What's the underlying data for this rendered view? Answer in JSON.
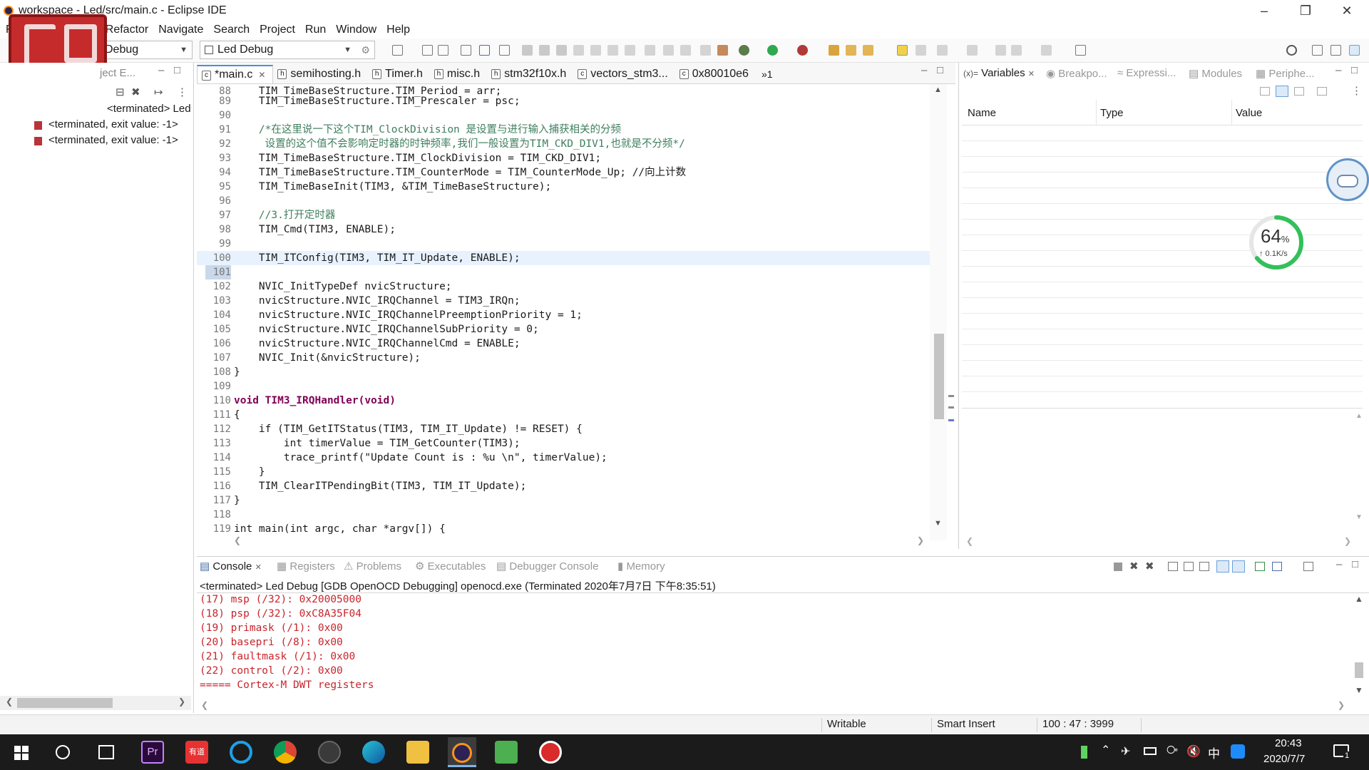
{
  "window": {
    "title": "workspace - Led/src/main.c - Eclipse IDE"
  },
  "menu": [
    "F",
    "Refactor",
    "Navigate",
    "Search",
    "Project",
    "Run",
    "Window",
    "Help"
  ],
  "toolbar": {
    "launch_mode_partial": "Debug",
    "launch_config": "Led Debug"
  },
  "left_panel": {
    "tab_partial": "ject E...",
    "tree": [
      "<terminated> Led Debug [GDE",
      "<terminated, exit value: -1>",
      "<terminated, exit value: -1>"
    ]
  },
  "editor": {
    "tabs": [
      "*main.c",
      "semihosting.h",
      "Timer.h",
      "misc.h",
      "stm32f10x.h",
      "vectors_stm3...",
      "0x80010e6"
    ],
    "overflow": "»1",
    "lines": [
      {
        "n": "88",
        "t": "    TIM_TimeBaseStructure.TIM_Period = arr;"
      },
      {
        "n": "89",
        "t": "    TIM_TimeBaseStructure.TIM_Prescaler = psc;"
      },
      {
        "n": "90",
        "t": ""
      },
      {
        "n": "91",
        "t": "    /*在这里说一下这个TIM_ClockDivision 是设置与进行输入捕获相关的分频"
      },
      {
        "n": "92",
        "t": "     设置的这个值不会影响定时器的时钟频率,我们一般设置为TIM_CKD_DIV1,也就是不分频*/"
      },
      {
        "n": "93",
        "t": "    TIM_TimeBaseStructure.TIM_ClockDivision = TIM_CKD_DIV1;"
      },
      {
        "n": "94",
        "t": "    TIM_TimeBaseStructure.TIM_CounterMode = TIM_CounterMode_Up; //向上计数"
      },
      {
        "n": "95",
        "t": "    TIM_TimeBaseInit(TIM3, &TIM_TimeBaseStructure);"
      },
      {
        "n": "96",
        "t": ""
      },
      {
        "n": "97",
        "t": "    //3.打开定时器"
      },
      {
        "n": "98",
        "t": "    TIM_Cmd(TIM3, ENABLE);"
      },
      {
        "n": "99",
        "t": ""
      },
      {
        "n": "100",
        "t": "    TIM_ITConfig(TIM3, TIM_IT_Update, ENABLE);"
      },
      {
        "n": "101",
        "t": ""
      },
      {
        "n": "102",
        "t": "    NVIC_InitTypeDef nvicStructure;"
      },
      {
        "n": "103",
        "t": "    nvicStructure.NVIC_IRQChannel = TIM3_IRQn;"
      },
      {
        "n": "104",
        "t": "    nvicStructure.NVIC_IRQChannelPreemptionPriority = 1;"
      },
      {
        "n": "105",
        "t": "    nvicStructure.NVIC_IRQChannelSubPriority = 0;"
      },
      {
        "n": "106",
        "t": "    nvicStructure.NVIC_IRQChannelCmd = ENABLE;"
      },
      {
        "n": "107",
        "t": "    NVIC_Init(&nvicStructure);"
      },
      {
        "n": "108",
        "t": "}"
      },
      {
        "n": "109",
        "t": ""
      },
      {
        "n": "110",
        "t": "void TIM3_IRQHandler(void)"
      },
      {
        "n": "111",
        "t": "{"
      },
      {
        "n": "112",
        "t": "    if (TIM_GetITStatus(TIM3, TIM_IT_Update) != RESET) {"
      },
      {
        "n": "113",
        "t": "        int timerValue = TIM_GetCounter(TIM3);"
      },
      {
        "n": "114",
        "t": "        trace_printf(\"Update Count is : %u \\n\", timerValue);"
      },
      {
        "n": "115",
        "t": "    }"
      },
      {
        "n": "116",
        "t": "    TIM_ClearITPendingBit(TIM3, TIM_IT_Update);"
      },
      {
        "n": "117",
        "t": "}"
      },
      {
        "n": "118",
        "t": ""
      },
      {
        "n": "119",
        "t": "int main(int argc, char *argv[]) {"
      }
    ]
  },
  "right_panel": {
    "tabs": [
      "Variables",
      "Breakpo...",
      "Expressi...",
      "Modules",
      "Periphe..."
    ],
    "columns": [
      "Name",
      "Type",
      "Value"
    ],
    "net_widget": {
      "percent": "64",
      "unit": "%",
      "speed": "↑ 0.1K/s",
      "level": 0.64
    }
  },
  "console": {
    "tabs": [
      "Console",
      "Registers",
      "Problems",
      "Executables",
      "Debugger Console",
      "Memory"
    ],
    "header": "<terminated> Led Debug [GDB OpenOCD Debugging] openocd.exe (Terminated 2020年7月7日 下午8:35:51)",
    "lines": [
      "(17) msp (/32): 0x20005000",
      "(18) psp (/32): 0xC8A35F04",
      "(19) primask (/1): 0x00",
      "(20) basepri (/8): 0x00",
      "(21) faultmask (/1): 0x00",
      "(22) control (/2): 0x00",
      "===== Cortex-M DWT registers"
    ]
  },
  "status": {
    "writable": "Writable",
    "insert_mode": "Smart Insert",
    "position": "100 : 47 : 3999"
  },
  "taskbar": {
    "time": "20:43",
    "date": "2020/7/7",
    "ime": "中",
    "notifications": "1",
    "pr_label": "Pr",
    "youdao_label": "有道"
  },
  "colors": {
    "keyword": "#7f0055",
    "comment": "#3f7f5f",
    "field": "#0000c0",
    "console_text": "#c8252c",
    "accent": "#4a8fd9"
  }
}
